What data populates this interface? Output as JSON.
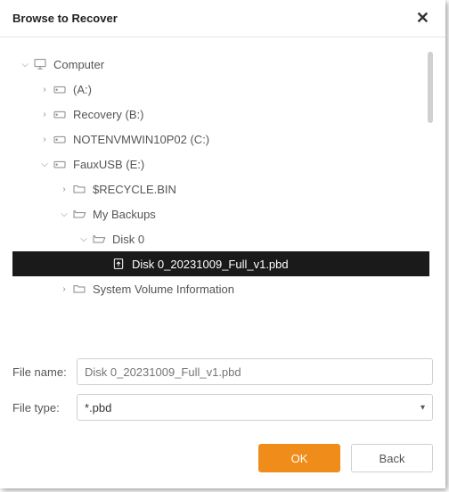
{
  "header": {
    "title": "Browse to Recover"
  },
  "tree": {
    "computer": "Computer",
    "drive_a": "(A:)",
    "drive_recovery": "Recovery (B:)",
    "drive_notenvm": "NOTENVMWIN10P02 (C:)",
    "drive_fauxusb": "FauxUSB (E:)",
    "recycle": "$RECYCLE.BIN",
    "my_backups": "My Backups",
    "disk0": "Disk 0",
    "disk0_file": "Disk 0_20231009_Full_v1.pbd",
    "sys_vol": "System Volume Information"
  },
  "form": {
    "filename_label": "File name:",
    "filename_value": "Disk 0_20231009_Full_v1.pbd",
    "filetype_label": "File type:",
    "filetype_value": "*.pbd"
  },
  "buttons": {
    "ok": "OK",
    "back": "Back"
  }
}
